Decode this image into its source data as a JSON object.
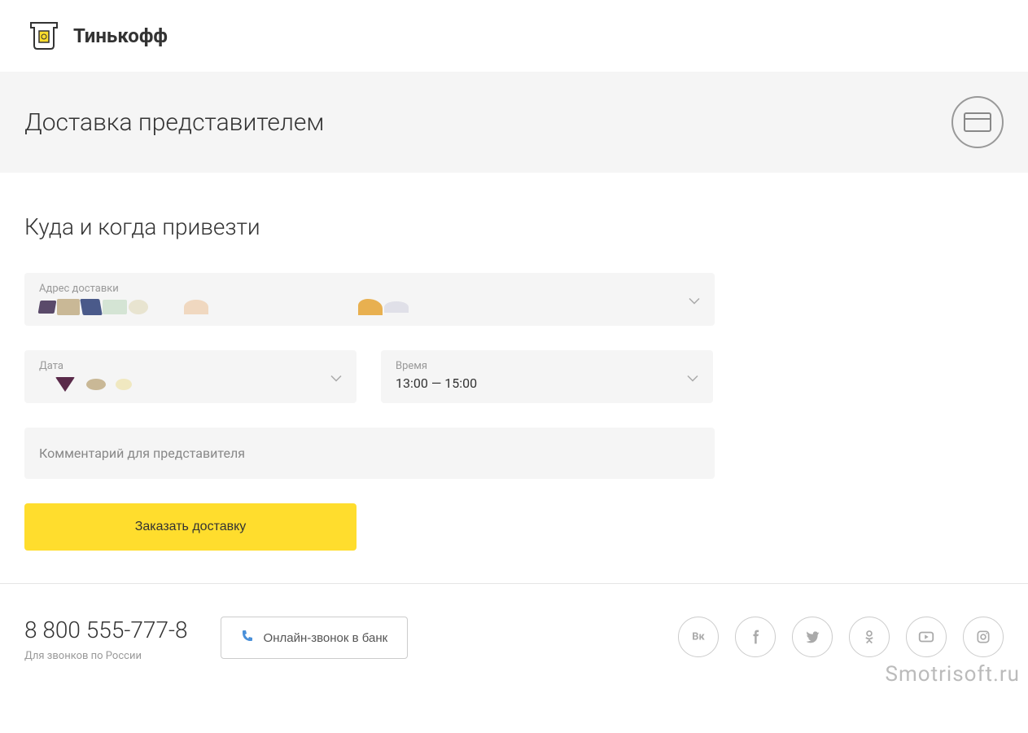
{
  "brand": "Тинькофф",
  "subheader": {
    "title": "Доставка представителем"
  },
  "section": {
    "title": "Куда и когда привезти"
  },
  "fields": {
    "address": {
      "label": "Адрес доставки"
    },
    "date": {
      "label": "Дата"
    },
    "time": {
      "label": "Время",
      "value": "13:00 — 15:00"
    },
    "comment": {
      "placeholder": "Комментарий для представителя"
    }
  },
  "button": {
    "submit": "Заказать доставку"
  },
  "footer": {
    "phone": "8 800 555-777-8",
    "phone_caption": "Для звонков по России",
    "call_button": "Онлайн-звонок в банк"
  },
  "watermark": "Smotrisoft.ru"
}
